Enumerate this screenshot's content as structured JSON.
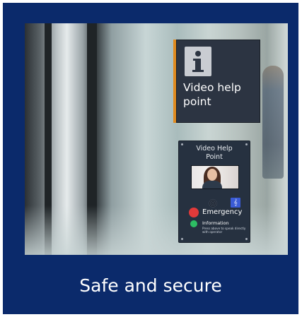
{
  "photo": {
    "top_sign": {
      "label_line1": "Video help",
      "label_line2": "point",
      "icon": "info-icon"
    },
    "panel": {
      "title_line1": "Video Help",
      "title_line2": "Point",
      "emergency_label": "Emergency",
      "information_label": "Information",
      "note": "Press above to speak directly with operator",
      "icons": [
        "speaker-grille-icon",
        "hearing-loop-icon"
      ]
    }
  },
  "caption": "Safe and secure",
  "colors": {
    "background": "#0b2a6b",
    "sign_accent": "#e08a1e",
    "emergency_button": "#e23a3a",
    "information_button": "#2dbd63"
  }
}
